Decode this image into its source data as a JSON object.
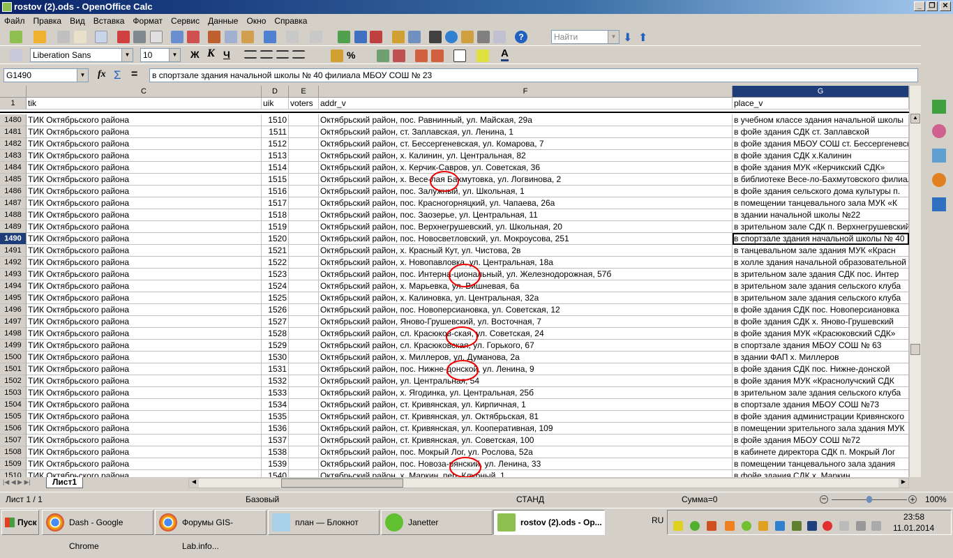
{
  "window": {
    "title": "rostov (2).ods - OpenOffice Calc"
  },
  "menu": [
    "Файл",
    "Правка",
    "Вид",
    "Вставка",
    "Формат",
    "Сервис",
    "Данные",
    "Окно",
    "Справка"
  ],
  "toolbar": {
    "search_placeholder": "Найти",
    "font_name": "Liberation Sans",
    "font_size": "10",
    "bold": "Ж",
    "italic": "К",
    "underline": "Ч"
  },
  "formula_bar": {
    "cell_ref": "G1490",
    "fx": "fx",
    "sum": "Σ",
    "equals": "=",
    "content": "в спортзале здания начальной школы № 40 филиала МБОУ СОШ № 23"
  },
  "columns": [
    {
      "letter": "C",
      "header": "tik"
    },
    {
      "letter": "D",
      "header": "uik"
    },
    {
      "letter": "E",
      "header": "voters"
    },
    {
      "letter": "F",
      "header": "addr_v"
    },
    {
      "letter": "G",
      "header": "place_v"
    }
  ],
  "header_row": "1",
  "selected_row": "1490",
  "rows": [
    [
      "1480",
      "ТИК Октябрьского района",
      "1510",
      "",
      "Октябрьский район, пос. Равнинный, ул. Майская, 29а",
      "в учебном классе здания начальной школы"
    ],
    [
      "1481",
      "ТИК Октябрьского района",
      "1511",
      "",
      "Октябрьский район, ст. Заплавская, ул. Ленина, 1",
      "в фойе здания СДК ст. Заплавской"
    ],
    [
      "1482",
      "ТИК Октябрьского района",
      "1512",
      "",
      "Октябрьский район, ст. Бессергеневская, ул. Комарова, 7",
      "в фойе здания МБОУ СОШ ст. Бессергеневской"
    ],
    [
      "1483",
      "ТИК Октябрьского района",
      "1513",
      "",
      "Октябрьский район, х. Калинин, ул. Центральная, 82",
      "в фойе здания СДК х.Калинин"
    ],
    [
      "1484",
      "ТИК Октябрьского района",
      "1514",
      "",
      "Октябрьский район, х. Керчик-Савров, ул. Советская, 36",
      "в фойе здания МУК «Керчикский СДК»"
    ],
    [
      "1485",
      "ТИК Октябрьского района",
      "1515",
      "",
      "Октябрьский район, х. Весе-лая Бахмутовка, ул. Логвинова, 2",
      "в библиотеке Весе-ло-Бахмутовского филиала"
    ],
    [
      "1486",
      "ТИК Октябрьского района",
      "1516",
      "",
      "Октябрьский район, пос. Залужный, ул. Школьная, 1",
      "в фойе здания сельского дома культуры п."
    ],
    [
      "1487",
      "ТИК Октябрьского района",
      "1517",
      "",
      "Октябрьский район, пос. Красногорняцкий, ул. Чапаева, 26а",
      "в помещении танцевального зала МУК «К"
    ],
    [
      "1488",
      "ТИК Октябрьского района",
      "1518",
      "",
      "Октябрьский район, пос. Заозерье, ул. Центральная, 11",
      "в здании начальной школы №22"
    ],
    [
      "1489",
      "ТИК Октябрьского района",
      "1519",
      "",
      "Октябрьский район, пос. Верхнегрушевский, ул. Школьная, 20",
      "в зрительном зале СДК п. Верхнегрушевский"
    ],
    [
      "1490",
      "ТИК Октябрьского района",
      "1520",
      "",
      "Октябрьский район, пос. Новосветловский, ул. Мокроусова, 251",
      "в спортзале здания начальной школы № 40"
    ],
    [
      "1491",
      "ТИК Октябрьского района",
      "1521",
      "",
      "Октябрьский район, х. Красный Кут, ул. Чистова, 2в",
      "в танцевальном зале здания МУК «Красн"
    ],
    [
      "1492",
      "ТИК Октябрьского района",
      "1522",
      "",
      "Октябрьский район, х. Новопавловка, ул. Центральная, 18а",
      "в холле здания начальной образовательной"
    ],
    [
      "1493",
      "ТИК Октябрьского района",
      "1523",
      "",
      "Октябрьский район, пос. Интерна-циональный, ул. Железнодорожная, 57б",
      "в зрительном зале здания СДК пос. Интер"
    ],
    [
      "1494",
      "ТИК Октябрьского района",
      "1524",
      "",
      "Октябрьский район, х. Марьевка, ул. Вишневая, 6а",
      "в зрительном зале здания сельского клуба"
    ],
    [
      "1495",
      "ТИК Октябрьского района",
      "1525",
      "",
      "Октябрьский район, х. Калиновка, ул. Центральная, 32а",
      "в зрительном зале здания сельского клуба"
    ],
    [
      "1496",
      "ТИК Октябрьского района",
      "1526",
      "",
      "Октябрьский район, пос. Новоперсиановка, ул. Советская, 12",
      "в фойе здания СДК пос. Новоперсиановка"
    ],
    [
      "1497",
      "ТИК Октябрьского района",
      "1527",
      "",
      "Октябрьский район, Яново-Грушевский, ул. Восточная, 7",
      "в фойе здания СДК х. Яново-Грушевский"
    ],
    [
      "1498",
      "ТИК Октябрьского района",
      "1528",
      "",
      "Октябрьский район, сл. Красюков-ская, ул. Советская, 24",
      "в фойе здания МУК «Красюковский СДК»"
    ],
    [
      "1499",
      "ТИК Октябрьского района",
      "1529",
      "",
      "Октябрьский район, сл. Красюковская, ул. Горького, 67",
      "в спортзале здания МБОУ СОШ № 63"
    ],
    [
      "1500",
      "ТИК Октябрьского района",
      "1530",
      "",
      "Октябрьский район, х. Миллеров, ул. Думанова, 2а",
      "в здании ФАП х. Миллеров"
    ],
    [
      "1501",
      "ТИК Октябрьского района",
      "1531",
      "",
      "Октябрьский район, пос. Нижне-донской, ул. Ленина, 9",
      "в фойе здания СДК пос. Нижне-донской"
    ],
    [
      "1502",
      "ТИК Октябрьского района",
      "1532",
      "",
      "Октябрьский район, ул. Центральная, 54",
      "в фойе здания МУК «Краснолучский СДК"
    ],
    [
      "1503",
      "ТИК Октябрьского района",
      "1533",
      "",
      "Октябрьский район, х. Ягодинка, ул. Центральная, 25б",
      "в зрительном зале здания сельского клуба"
    ],
    [
      "1504",
      "ТИК Октябрьского района",
      "1534",
      "",
      "Октябрьский район, ст. Кривянская, ул. Кирпичная, 1",
      "в спортзале здания МБОУ СОШ №73"
    ],
    [
      "1505",
      "ТИК Октябрьского района",
      "1535",
      "",
      "Октябрьский район, ст. Кривянская, ул. Октябрьская, 81",
      "в фойе здания администрации Кривянского"
    ],
    [
      "1506",
      "ТИК Октябрьского района",
      "1536",
      "",
      "Октябрьский район, ст. Кривянская, ул. Кооперативная, 109",
      "в помещении зрительного зала здания МУК"
    ],
    [
      "1507",
      "ТИК Октябрьского района",
      "1537",
      "",
      "Октябрьский район, ст. Кривянская, ул. Советская, 100",
      "в фойе здания МБОУ СОШ №72"
    ],
    [
      "1508",
      "ТИК Октябрьского района",
      "1538",
      "",
      "Октябрьский район, пос. Мокрый Лог, ул. Рослова, 52а",
      "в кабинете директора СДК п. Мокрый Лог"
    ],
    [
      "1509",
      "ТИК Октябрьского района",
      "1539",
      "",
      "Октябрьский район, пос. Новоза-рянский, ул. Ленина, 33",
      "в помещении танцевального зала здания"
    ],
    [
      "1510",
      "ТИК Октябрьского района",
      "1540",
      "",
      "Октябрьский район, х. Маркин, пер. Клубный, 1",
      "в фойе здания СДК х. Маркин"
    ]
  ],
  "sheet_tabs": [
    "Лист1"
  ],
  "status": {
    "sheet": "Лист 1 / 1",
    "style": "Базовый",
    "mode": "СТАНД",
    "sum": "Сумма=0",
    "zoom": "100%",
    "zoom_value": 100
  },
  "taskbar": {
    "start": "Пуск",
    "tasks": [
      "Dash - Google Chrome",
      "Форумы GIS-Lab.info...",
      "план — Блокнот",
      "Janetter",
      "rostov (2).ods - Op..."
    ],
    "lang": "RU",
    "time": "23:58",
    "date": "11.01.2014"
  }
}
